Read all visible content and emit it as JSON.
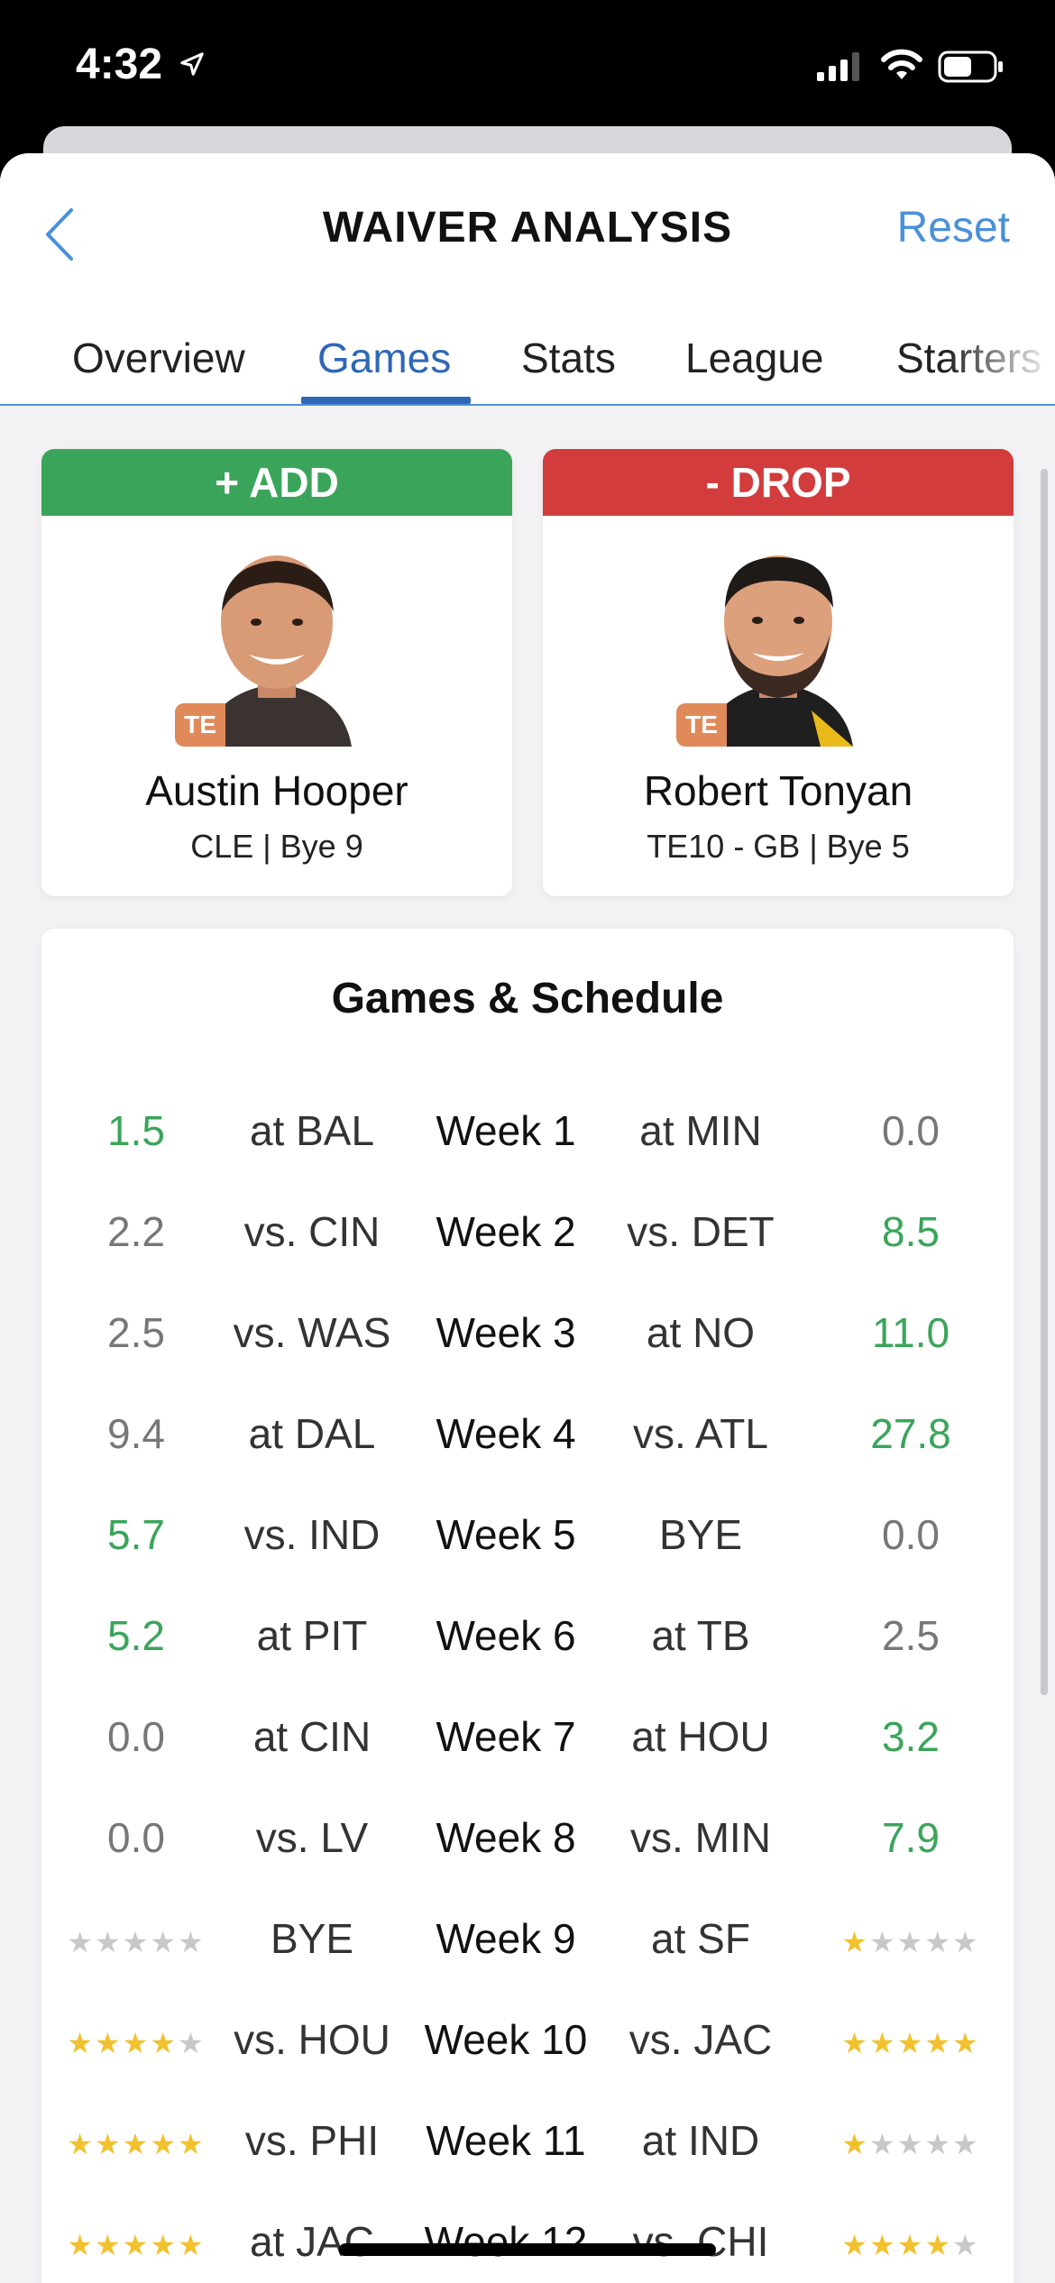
{
  "status": {
    "time": "4:32"
  },
  "nav": {
    "title": "WAIVER ANALYSIS",
    "reset": "Reset"
  },
  "tabs": [
    {
      "label": "Overview"
    },
    {
      "label": "Games"
    },
    {
      "label": "Stats"
    },
    {
      "label": "League"
    },
    {
      "label": "Starters"
    }
  ],
  "add_card": {
    "header": "+ ADD",
    "position": "TE",
    "name": "Austin Hooper",
    "details": "CLE | Bye 9"
  },
  "drop_card": {
    "header": "- DROP",
    "position": "TE",
    "name": "Robert Tonyan",
    "details": "TE10 - GB | Bye 5"
  },
  "schedule": {
    "title": "Games & Schedule",
    "rows": [
      {
        "left": "1.5",
        "left_color": "green",
        "left_opp": "at BAL",
        "week": "Week 1",
        "right_opp": "at MIN",
        "right": "0.0",
        "right_color": "grey"
      },
      {
        "left": "2.2",
        "left_color": "grey",
        "left_opp": "vs. CIN",
        "week": "Week 2",
        "right_opp": "vs. DET",
        "right": "8.5",
        "right_color": "green"
      },
      {
        "left": "2.5",
        "left_color": "grey",
        "left_opp": "vs. WAS",
        "week": "Week 3",
        "right_opp": "at NO",
        "right": "11.0",
        "right_color": "green"
      },
      {
        "left": "9.4",
        "left_color": "grey",
        "left_opp": "at DAL",
        "week": "Week 4",
        "right_opp": "vs. ATL",
        "right": "27.8",
        "right_color": "green"
      },
      {
        "left": "5.7",
        "left_color": "green",
        "left_opp": "vs. IND",
        "week": "Week 5",
        "right_opp": "BYE",
        "right": "0.0",
        "right_color": "grey"
      },
      {
        "left": "5.2",
        "left_color": "green",
        "left_opp": "at PIT",
        "week": "Week 6",
        "right_opp": "at TB",
        "right": "2.5",
        "right_color": "grey"
      },
      {
        "left": "0.0",
        "left_color": "grey",
        "left_opp": "at CIN",
        "week": "Week 7",
        "right_opp": "at HOU",
        "right": "3.2",
        "right_color": "green"
      },
      {
        "left": "0.0",
        "left_color": "grey",
        "left_opp": "vs. LV",
        "week": "Week 8",
        "right_opp": "vs. MIN",
        "right": "7.9",
        "right_color": "green"
      },
      {
        "left_stars": 0,
        "left_opp": "BYE",
        "week": "Week 9",
        "right_opp": "at SF",
        "right_stars": 1
      },
      {
        "left_stars": 4,
        "left_opp": "vs. HOU",
        "week": "Week 10",
        "right_opp": "vs. JAC",
        "right_stars": 5
      },
      {
        "left_stars": 5,
        "left_opp": "vs. PHI",
        "week": "Week 11",
        "right_opp": "at IND",
        "right_stars": 1
      },
      {
        "left_stars": 5,
        "left_opp": "at JAC",
        "week": "Week 12",
        "right_opp": "vs. CHI",
        "right_stars": 4
      }
    ]
  }
}
